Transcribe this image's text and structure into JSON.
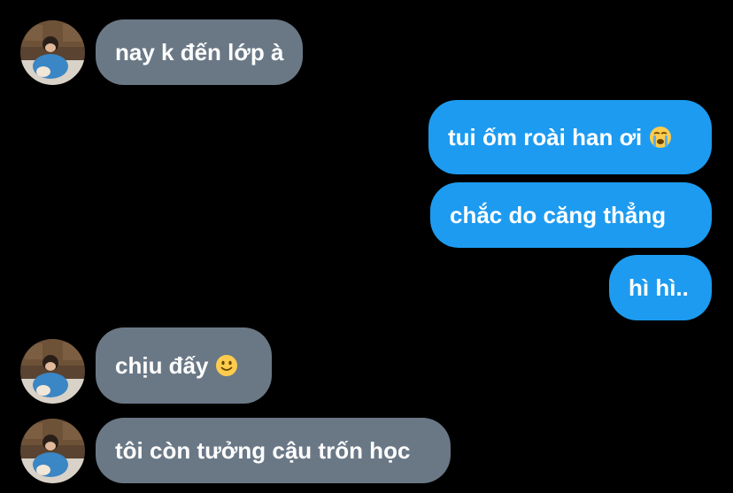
{
  "conversation": {
    "messages": [
      {
        "sender": "other",
        "text": "nay k đến lớp à"
      },
      {
        "sender": "me",
        "text": "tui ốm roài han ơi",
        "emoji": "loudly-crying-face-icon"
      },
      {
        "sender": "me",
        "text": "chắc do căng thẳng"
      },
      {
        "sender": "me",
        "text": "hì hì.."
      },
      {
        "sender": "other",
        "text": "chịu đấy",
        "emoji": "slightly-smiling-face-icon"
      },
      {
        "sender": "other",
        "text": "tôi còn tưởng cậu trốn học"
      }
    ]
  },
  "colors": {
    "background": "#000000",
    "incoming_bubble": "#6a7886",
    "outgoing_bubble": "#1d9bf0",
    "text": "#ffffff"
  }
}
